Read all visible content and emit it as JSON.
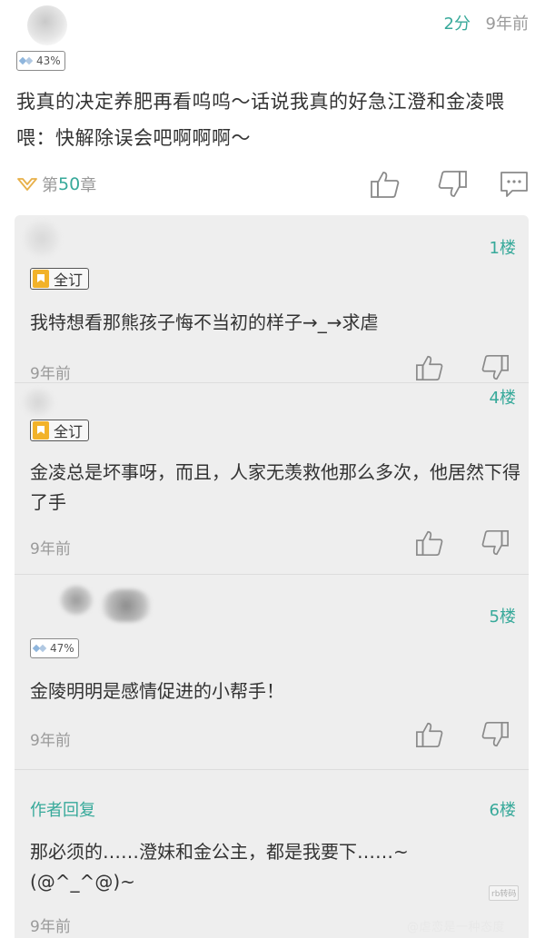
{
  "comment": {
    "score": "2分",
    "time": "9年前",
    "badge": "43%",
    "text": "我真的决定养肥再看呜呜～话说我真的好急江澄和金凌喂喂：快解除误会吧啊啊啊～",
    "chapter_prefix": "第",
    "chapter_num": "50",
    "chapter_suffix": "章"
  },
  "replies": [
    {
      "floor": "1楼",
      "badge": "全订",
      "text": "我特想看那熊孩子悔不当初的样子→_→求虐",
      "time": "9年前"
    },
    {
      "floor": "4楼",
      "badge": "全订",
      "text": "金凌总是坏事呀，而且，人家无羡救他那么多次，他居然下得了手",
      "time": "9年前"
    },
    {
      "floor": "5楼",
      "badge": "47%",
      "text": "金陵明明是感情促进的小帮手！",
      "time": "9年前"
    },
    {
      "floor": "6楼",
      "name": "作者回复",
      "text": "那必须的……澄妹和金公主，都是我要下……~(@^_^@)~",
      "time": "9年前"
    }
  ],
  "corner_tag": "rb转码",
  "watermark": "@虐恋是一种态度",
  "colors": {
    "accent": "#37a99a",
    "muted": "#9a9a9a",
    "panel": "#eeeeee"
  }
}
